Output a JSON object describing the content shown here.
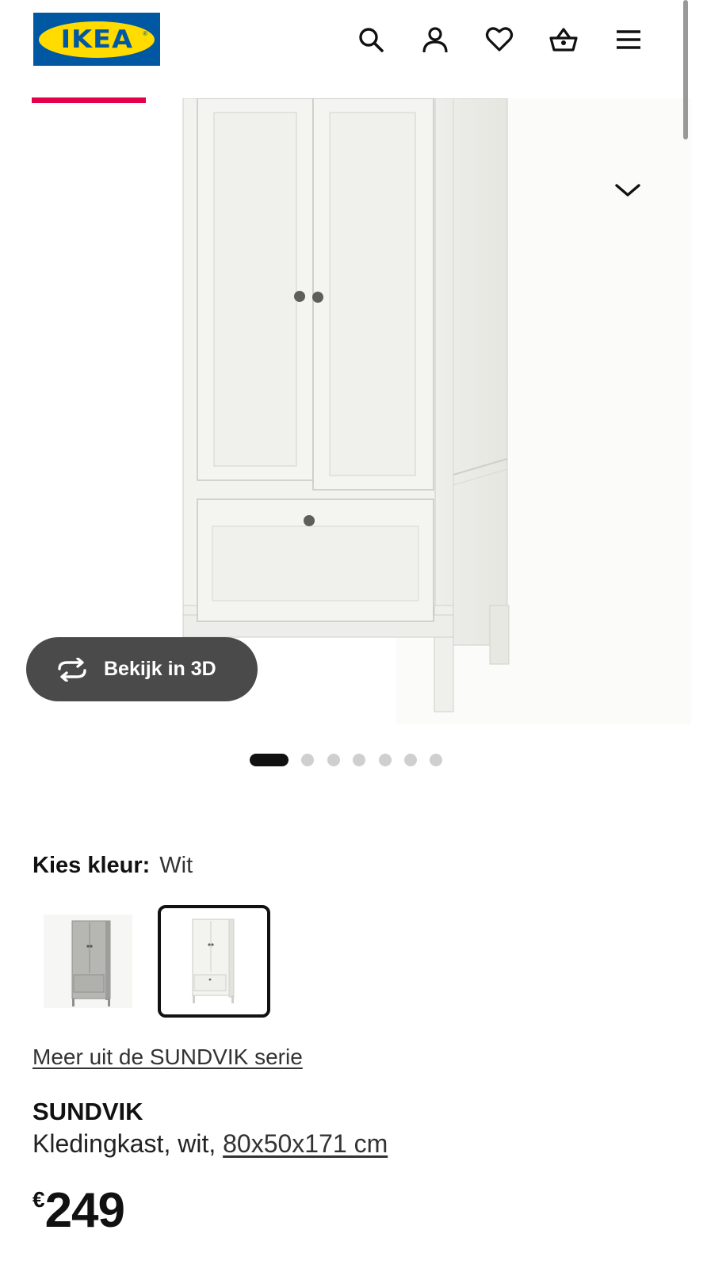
{
  "header": {
    "logo_text": "IKEA",
    "icons": [
      "search-icon",
      "user-icon",
      "heart-icon",
      "basket-icon",
      "menu-icon"
    ]
  },
  "colors": {
    "brand_blue": "#0058a3",
    "brand_yellow": "#ffdb00",
    "active_tab": "#e5004b",
    "button_3d_bg": "#4a4a4a"
  },
  "gallery": {
    "view_3d_label": "Bekijk in 3D",
    "image_count": 7,
    "active_image_index": 0
  },
  "colour_picker": {
    "label": "Kies kleur:",
    "selected_value": "Wit",
    "swatch_count": 2,
    "selected_swatch_index": 1
  },
  "product": {
    "series_link": "Meer uit de SUNDVIK serie",
    "name": "SUNDVIK",
    "description_prefix": "Kledingkast, wit, ",
    "dimensions": "80x50x171 cm",
    "currency": "€",
    "price": "249"
  }
}
